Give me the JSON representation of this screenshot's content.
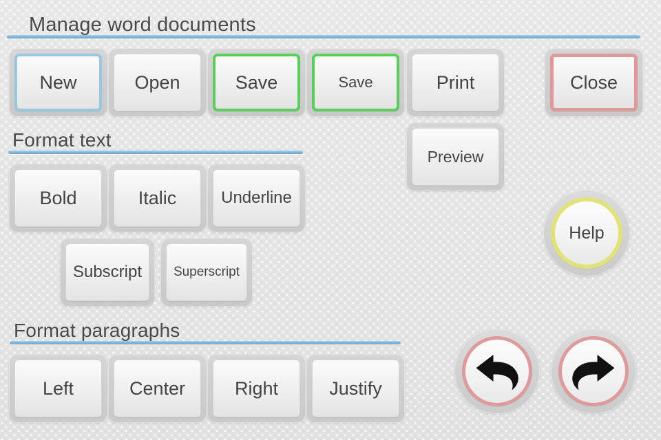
{
  "app": {
    "title_bar_absent": true
  },
  "sections": [
    {
      "id": "manage",
      "heading": "Manage word documents",
      "buttons": [
        {
          "label": "New",
          "accent": "blue",
          "accent_color": "#9cc6de"
        },
        {
          "label": "Open",
          "accent": "none",
          "accent_color": ""
        },
        {
          "label": "Save",
          "accent": "green",
          "accent_color": "#5ace5a"
        },
        {
          "label": "Save",
          "accent": "green",
          "accent_color": "#5ace5a"
        },
        {
          "label": "Print",
          "accent": "none",
          "accent_color": ""
        },
        {
          "label": "Close",
          "accent": "red",
          "accent_color": "#dd9a9a"
        },
        {
          "label": "Preview",
          "accent": "none",
          "accent_color": ""
        }
      ]
    },
    {
      "id": "format-text",
      "heading": "Format text",
      "buttons": [
        {
          "label": "Bold"
        },
        {
          "label": "Italic"
        },
        {
          "label": "Underline"
        },
        {
          "label": "Subscript"
        },
        {
          "label": "Superscript"
        }
      ]
    },
    {
      "id": "format-paragraphs",
      "heading": "Format paragraphs",
      "buttons": [
        {
          "label": "Left"
        },
        {
          "label": "Center"
        },
        {
          "label": "Right"
        },
        {
          "label": "Justify"
        }
      ]
    }
  ],
  "help": {
    "label": "Help",
    "ring_color": "#e3e27a"
  },
  "history": {
    "undo": {
      "icon": "undo-arrow-icon",
      "ring_color": "#dd9b9b"
    },
    "redo": {
      "icon": "redo-arrow-icon",
      "ring_color": "#dd9b9b"
    }
  },
  "theme": {
    "rule_color": "#7fb4d6",
    "background": "#e6e6e6",
    "text_color": "#4a4a4a"
  }
}
